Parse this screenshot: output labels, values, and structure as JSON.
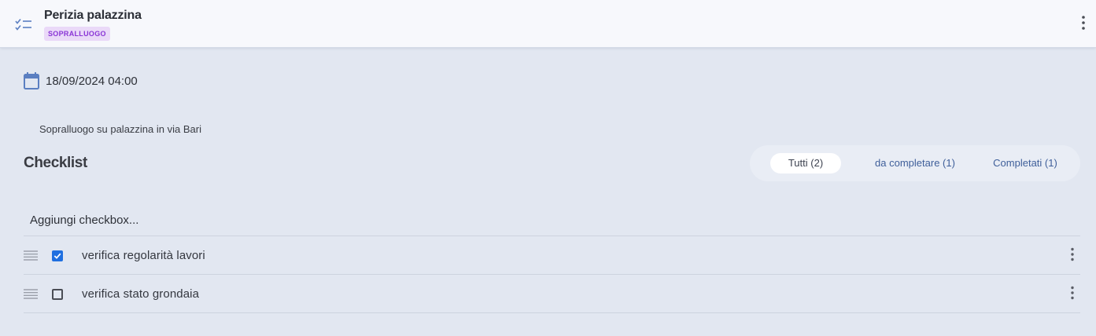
{
  "header": {
    "icon": "checklist-icon",
    "title": "Perizia palazzina",
    "badge": "SOPRALLUOGO",
    "menu_icon": "more-vertical-icon"
  },
  "details": {
    "date_icon": "calendar-icon",
    "date": "18/09/2024 04:00",
    "description": "Sopralluogo su palazzina in via Bari"
  },
  "checklist": {
    "title": "Checklist",
    "filters": [
      {
        "label": "Tutti (2)",
        "active": true
      },
      {
        "label": "da completare (1)",
        "active": false
      },
      {
        "label": "Completati (1)",
        "active": false
      }
    ],
    "add_placeholder": "Aggiungi checkbox...",
    "items": [
      {
        "label": "verifica regolarità lavori",
        "checked": true
      },
      {
        "label": "verifica stato grondaia",
        "checked": false
      }
    ]
  },
  "colors": {
    "background": "#e2e7f1",
    "header_bg": "#f7f8fc",
    "badge_bg": "#ead9f8",
    "badge_text": "#8a35d6",
    "checkbox_checked": "#1f6fe0",
    "filter_text": "#3f5f9a"
  }
}
